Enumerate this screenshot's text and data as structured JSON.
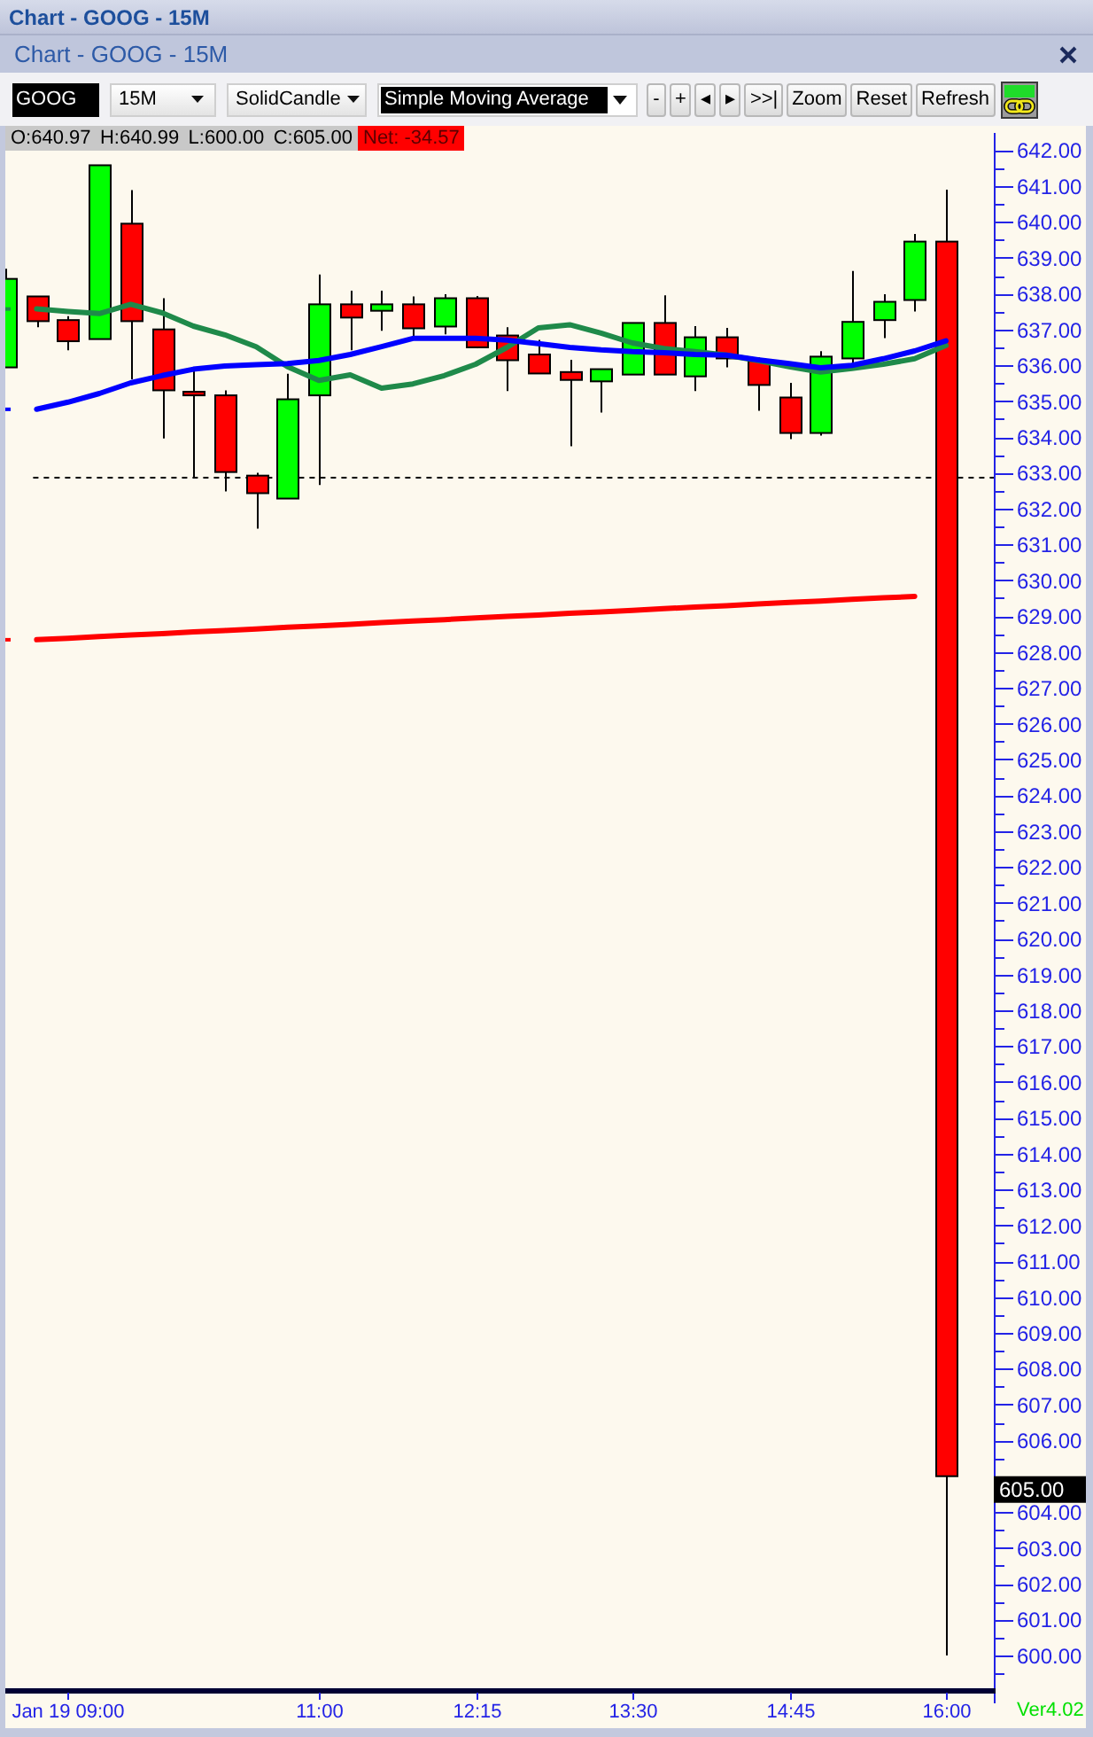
{
  "window": {
    "title": "Chart - GOOG - 15M"
  },
  "document": {
    "title": "Chart - GOOG - 15M"
  },
  "toolbar": {
    "symbol": "GOOG",
    "interval": "15M",
    "chart_type": "SolidCandle",
    "indicator": "Simple Moving Average",
    "buttons": [
      {
        "label": "-"
      },
      {
        "label": "+"
      },
      {
        "label": "◂"
      },
      {
        "label": "▸"
      },
      {
        "label": ">>|"
      },
      {
        "label": "Zoom"
      },
      {
        "label": "Reset"
      },
      {
        "label": "Refresh"
      }
    ]
  },
  "chart": {
    "quote": {
      "open": "O:640.97",
      "high": "H:640.99",
      "low": "L:600.00",
      "close": "C:605.00",
      "net": "Net: -34.57"
    },
    "last_price": "605.00",
    "version": "Ver4.02",
    "chart_data": {
      "type": "candlestick",
      "categories": [
        null,
        null,
        "Jan 19 09:00",
        null,
        null,
        null,
        null,
        null,
        null,
        null,
        "11:00",
        null,
        null,
        null,
        null,
        "12:15",
        null,
        null,
        null,
        null,
        "13:30",
        null,
        null,
        null,
        null,
        "14:45",
        null,
        null,
        null,
        null,
        "16:00"
      ],
      "ylim": [
        598.91,
        642.68
      ],
      "yticks": [
        {
          "value": 600,
          "label": "600.00"
        },
        {
          "value": 601,
          "label": "601.00"
        },
        {
          "value": 602,
          "label": "602.00"
        },
        {
          "value": 603,
          "label": "603.00"
        },
        {
          "value": 604,
          "label": "604.00"
        },
        {
          "value": 606,
          "label": "606.00"
        },
        {
          "value": 607,
          "label": "607.00"
        },
        {
          "value": 608,
          "label": "608.00"
        },
        {
          "value": 609,
          "label": "609.00"
        },
        {
          "value": 610,
          "label": "610.00"
        },
        {
          "value": 611,
          "label": "611.00"
        },
        {
          "value": 612,
          "label": "612.00"
        },
        {
          "value": 613,
          "label": "613.00"
        },
        {
          "value": 614,
          "label": "614.00"
        },
        {
          "value": 615,
          "label": "615.00"
        },
        {
          "value": 616,
          "label": "616.00"
        },
        {
          "value": 617,
          "label": "617.00"
        },
        {
          "value": 618,
          "label": "618.00"
        },
        {
          "value": 619,
          "label": "619.00"
        },
        {
          "value": 620,
          "label": "620.00"
        },
        {
          "value": 621,
          "label": "621.00"
        },
        {
          "value": 622,
          "label": "622.00"
        },
        {
          "value": 623,
          "label": "623.00"
        },
        {
          "value": 624,
          "label": "624.00"
        },
        {
          "value": 625,
          "label": "625.00"
        },
        {
          "value": 626,
          "label": "626.00"
        },
        {
          "value": 627,
          "label": "627.00"
        },
        {
          "value": 628,
          "label": "628.00"
        },
        {
          "value": 629,
          "label": "629.00"
        },
        {
          "value": 630,
          "label": "630.00"
        },
        {
          "value": 631,
          "label": "631.00"
        },
        {
          "value": 632,
          "label": "632.00"
        },
        {
          "value": 633,
          "label": "633.00"
        },
        {
          "value": 634,
          "label": "634.00"
        },
        {
          "value": 635,
          "label": "635.00"
        },
        {
          "value": 636,
          "label": "636.00"
        },
        {
          "value": 637,
          "label": "637.00"
        },
        {
          "value": 638,
          "label": "638.00"
        },
        {
          "value": 639,
          "label": "639.00"
        },
        {
          "value": 640,
          "label": "640.00"
        },
        {
          "value": 641,
          "label": "641.00"
        },
        {
          "value": 642,
          "label": "642.00"
        }
      ],
      "ohlc": [
        [
          635.94,
          638.69,
          635.94,
          638.41
        ],
        [
          637.92,
          637.92,
          637.06,
          637.23
        ],
        [
          637.26,
          637.37,
          636.42,
          636.67
        ],
        [
          636.73,
          641.58,
          636.73,
          641.58
        ],
        [
          639.95,
          640.89,
          635.61,
          637.23
        ],
        [
          637.0,
          637.87,
          633.96,
          635.3
        ],
        [
          635.26,
          635.84,
          632.89,
          635.16
        ],
        [
          635.16,
          635.3,
          632.48,
          633.02
        ],
        [
          632.92,
          633.0,
          631.44,
          632.43
        ],
        [
          632.28,
          635.76,
          632.28,
          635.05
        ],
        [
          635.16,
          638.53,
          632.66,
          637.7
        ],
        [
          637.7,
          638.08,
          636.42,
          637.33
        ],
        [
          637.52,
          638.08,
          636.96,
          637.7
        ],
        [
          637.7,
          637.92,
          636.81,
          637.03
        ],
        [
          637.08,
          637.98,
          636.86,
          637.87
        ],
        [
          637.87,
          637.93,
          636.47,
          636.5
        ],
        [
          636.83,
          637.06,
          635.28,
          636.14
        ],
        [
          636.3,
          636.71,
          635.77,
          635.77
        ],
        [
          635.81,
          636.15,
          633.74,
          635.59
        ],
        [
          635.55,
          635.89,
          634.68,
          635.89
        ],
        [
          635.74,
          637.18,
          635.74,
          637.18
        ],
        [
          637.18,
          637.95,
          635.74,
          635.74
        ],
        [
          635.69,
          637.09,
          635.28,
          636.78
        ],
        [
          636.78,
          637.04,
          635.94,
          636.19
        ],
        [
          636.12,
          636.22,
          634.73,
          635.45
        ],
        [
          635.1,
          635.51,
          633.94,
          634.11
        ],
        [
          634.11,
          636.39,
          634.04,
          636.24
        ],
        [
          636.19,
          638.63,
          636.05,
          637.21
        ],
        [
          637.26,
          637.98,
          636.76,
          637.77
        ],
        [
          637.82,
          639.66,
          637.5,
          639.45
        ],
        [
          639.45,
          640.9,
          600.0,
          605.0
        ]
      ],
      "series": [
        {
          "type": "line",
          "axis": "y",
          "color": "#1f8a4a",
          "values": [
            null,
            637.57,
            637.5,
            637.44,
            637.7,
            637.46,
            637.09,
            636.85,
            636.52,
            635.96,
            635.58,
            635.73,
            635.36,
            635.48,
            635.71,
            636.03,
            636.5,
            637.04,
            637.13,
            636.9,
            636.62,
            636.47,
            636.38,
            636.28,
            636.13,
            635.96,
            635.81,
            635.91,
            636.03,
            636.18,
            636.55
          ]
        },
        {
          "type": "line",
          "axis": "y",
          "color": "#0000ff",
          "values": [
            null,
            634.77,
            634.97,
            635.21,
            635.51,
            635.71,
            635.89,
            635.98,
            636.02,
            636.05,
            636.13,
            636.3,
            636.52,
            636.75,
            636.75,
            636.75,
            636.7,
            636.6,
            636.5,
            636.43,
            636.38,
            636.35,
            636.3,
            636.28,
            636.15,
            636.05,
            635.93,
            636.0,
            636.18,
            636.4,
            636.68
          ]
        },
        {
          "type": "line",
          "axis": "y",
          "color": "#ff0000",
          "values": [
            null,
            628.34,
            628.38,
            628.43,
            628.47,
            628.51,
            628.56,
            628.6,
            628.64,
            628.69,
            628.73,
            628.77,
            628.82,
            628.86,
            628.9,
            628.95,
            628.99,
            629.03,
            629.08,
            629.12,
            629.16,
            629.21,
            629.25,
            629.29,
            629.34,
            629.38,
            629.42,
            629.47,
            629.51,
            629.55,
            null
          ]
        }
      ],
      "ref_lines": [
        {
          "axis": "y",
          "value": 632.87
        }
      ]
    }
  }
}
